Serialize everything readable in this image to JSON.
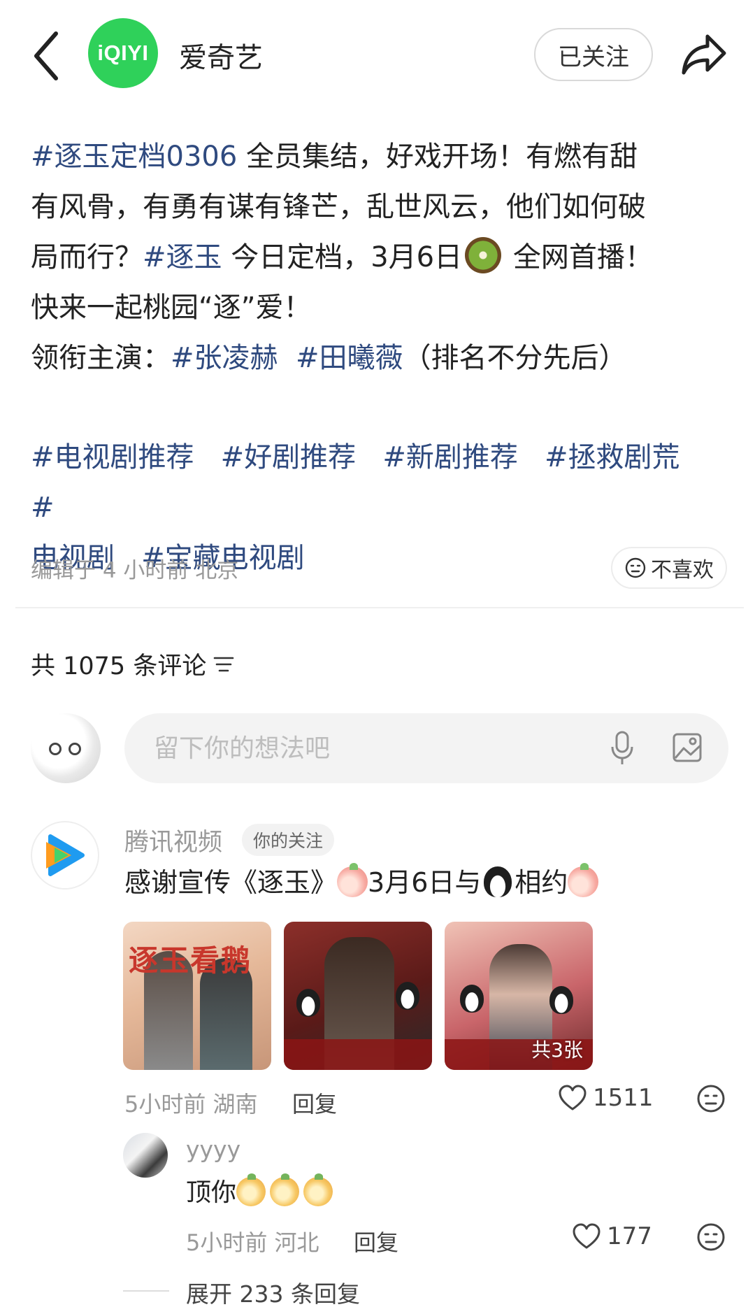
{
  "header": {
    "account_logo_text": "iQIYI",
    "account_name": "爱奇艺",
    "follow_label": "已关注"
  },
  "post": {
    "line1_tag": "#逐玉定档0306",
    "line1_text": " 全员集结，好戏开场！有燃有甜",
    "line2_text": "有风骨，有勇有谋有锋芒，乱世风云，他们如何破",
    "line3_pre": "局而行？",
    "line3_tag": "#逐玉",
    "line3_text": " 今日定档，3月6日",
    "line3_post": " 全网首播！",
    "line4_text": "快来一起桃园“逐”爱！",
    "line5_pre": "领衔主演：",
    "line5_tag1": "#张凌赫",
    "line5_tag2": "#田曦薇",
    "line5_post": "（排名不分先后）",
    "tags": [
      "#电视剧推荐",
      "#好剧推荐",
      "#新剧推荐",
      "#拯救剧荒",
      "#",
      "电视剧",
      "#宝藏电视剧"
    ],
    "meta": "编辑于 4 小时前 北京",
    "dislike_label": "不喜欢"
  },
  "comments_header": {
    "count_label": "共 1075 条评论"
  },
  "comment_input": {
    "placeholder": "留下你的想法吧"
  },
  "comment": {
    "author": "腾讯视频",
    "badge": "你的关注",
    "text_a": "感谢宣传《逐玉》",
    "text_b": "3月6日与",
    "text_c": "相约",
    "thumb1_title": "逐玉看鹅",
    "more_images": "共3张",
    "time_location": "5小时前 湖南",
    "reply_label": "回复",
    "likes": "1511"
  },
  "reply": {
    "author": "yyyy",
    "text": "顶你",
    "time_location": "5小时前 河北",
    "reply_label": "回复",
    "likes": "177"
  },
  "expand_label": "展开 233 条回复",
  "colors": {
    "tag": "#2f4a7f",
    "brand_green": "#2fd15a",
    "muted": "#999999"
  }
}
